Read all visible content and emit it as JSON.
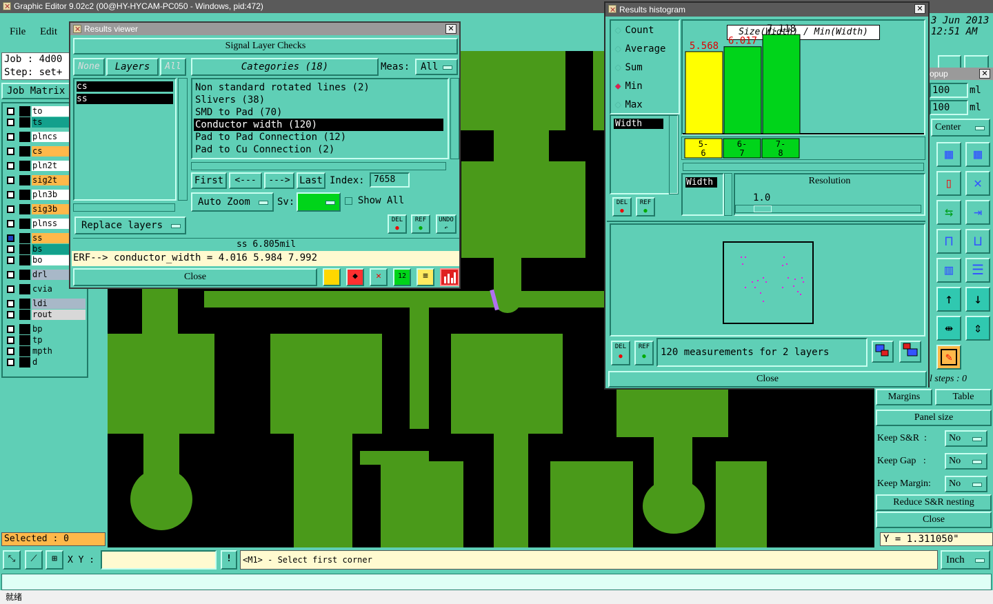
{
  "window_title": "Graphic Editor 9.02c2 (00@HY-HYCAM-PC050 - Windows, pid:472)",
  "menu": {
    "file": "File",
    "edit": "Edit"
  },
  "job": {
    "job_label": "Job : 4d00",
    "step_label": "Step: set+",
    "matrix_button": "Job Matrix"
  },
  "layers": [
    "to",
    "ts",
    "plncs",
    "cs",
    "pln2t",
    "sig2t",
    "pln3b",
    "sig3b",
    "plnss",
    "ss",
    "bs",
    "bo",
    "drl",
    "cvia",
    "ldi",
    "rout",
    "bp",
    "tp",
    "mpth",
    "d"
  ],
  "layer_colors": {
    "to": "#ffffff",
    "ts": "#13a08c",
    "plncs": "#ffffff",
    "cs": "#ffb84a",
    "pln2t": "#ffffff",
    "sig2t": "#ffb84a",
    "pln3b": "#ffffff",
    "sig3b": "#ffb84a",
    "plnss": "#ffffff",
    "ss": "#ffb84a",
    "bs": "#13a08c",
    "bo": "#ffffff",
    "drl": "#a8b8c8",
    "cvia": "#5fcfb6",
    "ldi": "#a8b8c8",
    "rout": "#d8d8d8",
    "bp": "#5fcfb6",
    "tp": "#5fcfb6",
    "mpth": "#5fcfb6",
    "d": "#5fcfb6"
  },
  "selected": "Selected : 0",
  "results_viewer": {
    "title": "Results viewer",
    "header": "Signal Layer Checks",
    "none": "None",
    "layers": "Layers",
    "all": "All",
    "layer_list": [
      "cs",
      "ss"
    ],
    "categories": "Categories (18)",
    "meas_label": "Meas:",
    "meas_value": "All",
    "category_items": [
      "Non standard rotated lines (2)",
      "Slivers (38)",
      "SMD to Pad (70)",
      "Conductor width (120)",
      "Pad to Pad Connection (12)",
      "Pad to Cu Connection (2)"
    ],
    "selected_category": "Conductor width (120)",
    "first": "First",
    "prev": "<---",
    "next": "--->",
    "last": "Last",
    "index_label": "Index:",
    "index_value": "7658",
    "auto_zoom": "Auto Zoom",
    "sv_label": "Sv:",
    "show_all": "Show All",
    "replace_layers": "Replace layers",
    "del": "DEL",
    "ref": "REF",
    "undo": "UNDO",
    "status": "ss 6.805mil",
    "erf": "ERF--> conductor_width = 4.016 5.984 7.992",
    "close": "Close"
  },
  "histogram": {
    "title": "Results histogram",
    "options": [
      "Count",
      "Average",
      "Sum",
      "Min",
      "Max"
    ],
    "selected_option": "Min",
    "size_label": "Size(Width) / Min(Width)",
    "list_item": "Width",
    "width_label": "Width",
    "resolution_label": "Resolution",
    "resolution_value": "1.0",
    "measurements": "120 measurements for 2 layers",
    "del": "DEL",
    "ref": "REF",
    "close": "Close"
  },
  "chart_data": {
    "type": "bar",
    "categories": [
      "5-\n6",
      "6-\n7",
      "7-\n8"
    ],
    "values": [
      5.568,
      6.017,
      7.118
    ],
    "value_labels": [
      "5.568",
      "6.017",
      "7.118"
    ],
    "colors": [
      "#ffff00",
      "#00d41a",
      "#00d41a"
    ],
    "label_colors": [
      "#e00000",
      "#e00000",
      "#000000"
    ],
    "ylim": [
      0,
      7.5
    ]
  },
  "right_panel": {
    "date": "3 Jun 2013",
    "time": "12:51 AM",
    "popup": "opup",
    "field1": "100",
    "unit1": "ml",
    "field2": "100",
    "unit2": "ml",
    "center": "Center",
    "steps": "l steps : 0",
    "margins": "Margins",
    "table": "Table",
    "panel_size": "Panel size",
    "keep_sr": "Keep S&R  :",
    "keep_sr_val": "No",
    "keep_gap": "Keep Gap   :",
    "keep_gap_val": "No",
    "keep_margin": "Keep Margin:",
    "keep_margin_val": "No",
    "reduce": "Reduce S&R nesting",
    "close": "Close",
    "y_coord": "Y = 1.311050\"",
    "units": "Inch"
  },
  "bottom": {
    "xy": "X Y :",
    "prompt": "<M1> - Select first corner",
    "taskbar": "就绪"
  }
}
